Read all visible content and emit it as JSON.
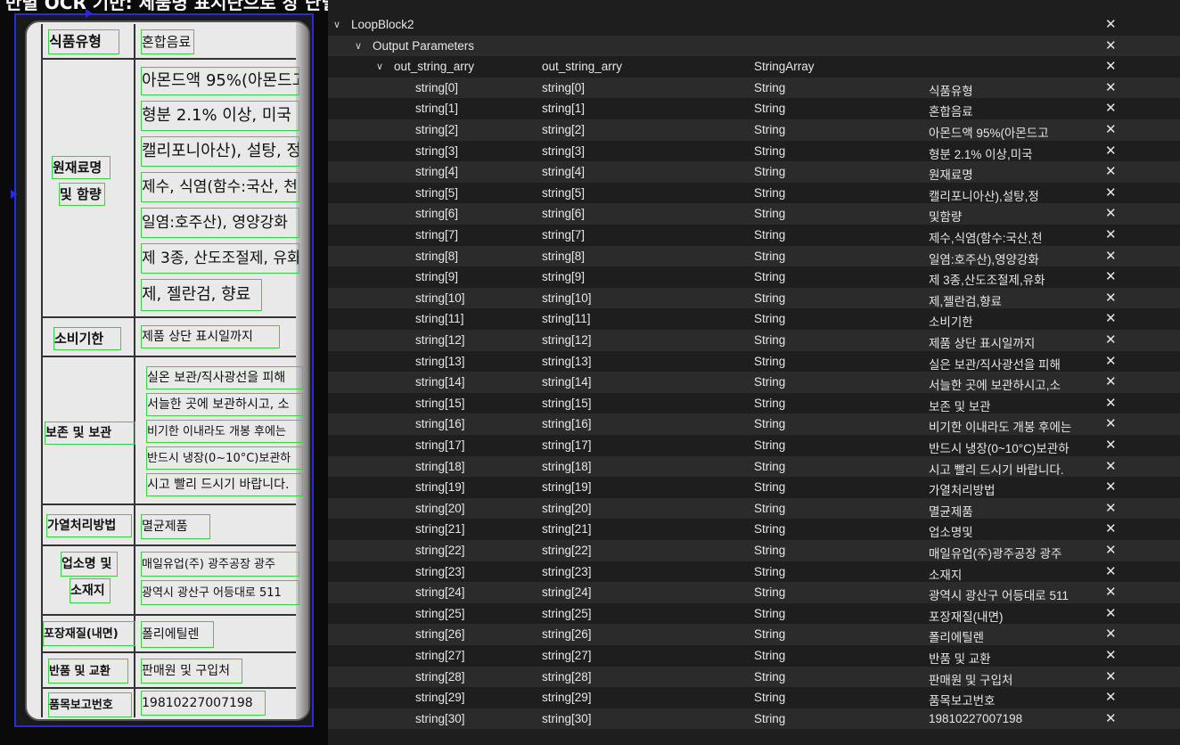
{
  "banner": {
    "text": "반별 OCR 기반: 제품명 표시란으로 장 단별 판정 텍스트 기"
  },
  "tree": {
    "root_label": "LoopBlock2",
    "group_label": "Output Parameters",
    "param": {
      "name": "out_string_arry",
      "display": "out_string_arry",
      "type": "StringArray"
    },
    "close_glyph": "✕",
    "rows": [
      {
        "name": "string[0]",
        "display": "string[0]",
        "type": "String",
        "value": "식품유형"
      },
      {
        "name": "string[1]",
        "display": "string[1]",
        "type": "String",
        "value": "혼합음료"
      },
      {
        "name": "string[2]",
        "display": "string[2]",
        "type": "String",
        "value": "아몬드액 95%(아몬드고"
      },
      {
        "name": "string[3]",
        "display": "string[3]",
        "type": "String",
        "value": "형분 2.1% 이상,미국"
      },
      {
        "name": "string[4]",
        "display": "string[4]",
        "type": "String",
        "value": "원재료명"
      },
      {
        "name": "string[5]",
        "display": "string[5]",
        "type": "String",
        "value": "캘리포니아산),설탕,정"
      },
      {
        "name": "string[6]",
        "display": "string[6]",
        "type": "String",
        "value": "및함량"
      },
      {
        "name": "string[7]",
        "display": "string[7]",
        "type": "String",
        "value": "제수,식염(함수:국산,천"
      },
      {
        "name": "string[8]",
        "display": "string[8]",
        "type": "String",
        "value": "일염:호주산),영양강화"
      },
      {
        "name": "string[9]",
        "display": "string[9]",
        "type": "String",
        "value": "제 3종,산도조절제,유화"
      },
      {
        "name": "string[10]",
        "display": "string[10]",
        "type": "String",
        "value": "제,젤란검,향료"
      },
      {
        "name": "string[11]",
        "display": "string[11]",
        "type": "String",
        "value": "소비기한"
      },
      {
        "name": "string[12]",
        "display": "string[12]",
        "type": "String",
        "value": "제품 상단 표시일까지"
      },
      {
        "name": "string[13]",
        "display": "string[13]",
        "type": "String",
        "value": "실은 보관/직사광선을 피해"
      },
      {
        "name": "string[14]",
        "display": "string[14]",
        "type": "String",
        "value": "서늘한 곳에 보관하시고,소"
      },
      {
        "name": "string[15]",
        "display": "string[15]",
        "type": "String",
        "value": "보존 및 보관"
      },
      {
        "name": "string[16]",
        "display": "string[16]",
        "type": "String",
        "value": "비기한 이내라도 개봉 후에는"
      },
      {
        "name": "string[17]",
        "display": "string[17]",
        "type": "String",
        "value": "반드시 냉장(0~10°C)보관하"
      },
      {
        "name": "string[18]",
        "display": "string[18]",
        "type": "String",
        "value": "시고 빨리 드시기 바랍니다."
      },
      {
        "name": "string[19]",
        "display": "string[19]",
        "type": "String",
        "value": "가열처리방법"
      },
      {
        "name": "string[20]",
        "display": "string[20]",
        "type": "String",
        "value": "멸균제품"
      },
      {
        "name": "string[21]",
        "display": "string[21]",
        "type": "String",
        "value": "업소명및"
      },
      {
        "name": "string[22]",
        "display": "string[22]",
        "type": "String",
        "value": "매일유업(주)광주공장 광주"
      },
      {
        "name": "string[23]",
        "display": "string[23]",
        "type": "String",
        "value": "소재지"
      },
      {
        "name": "string[24]",
        "display": "string[24]",
        "type": "String",
        "value": "광역시 광산구 어등대로 511"
      },
      {
        "name": "string[25]",
        "display": "string[25]",
        "type": "String",
        "value": "포장재질(내면)"
      },
      {
        "name": "string[26]",
        "display": "string[26]",
        "type": "String",
        "value": "폴리에틸렌"
      },
      {
        "name": "string[27]",
        "display": "string[27]",
        "type": "String",
        "value": "반품 및 교환"
      },
      {
        "name": "string[28]",
        "display": "string[28]",
        "type": "String",
        "value": "판매원 및 구입처"
      },
      {
        "name": "string[29]",
        "display": "string[29]",
        "type": "String",
        "value": "품목보고번호"
      },
      {
        "name": "string[30]",
        "display": "string[30]",
        "type": "String",
        "value": "19810227007198"
      }
    ]
  },
  "label_image": {
    "texts": [
      "식품유형",
      "혼합음료",
      "아몬드액 95%(아몬드고",
      "형분 2.1% 이상, 미국",
      "캘리포니아산), 설탕, 정",
      "원재료명",
      "및 함량",
      "제수, 식염(함수:국산, 천",
      "일염:호주산), 영양강화",
      "제 3종, 산도조절제, 유화",
      "제, 젤란검, 향료",
      "소비기한",
      "제품 상단 표시일까지",
      "실온 보관/직사광선을 피해",
      "서늘한 곳에 보관하시고, 소",
      "보존 및 보관",
      "비기한 이내라도 개봉 후에는",
      "반드시 냉장(0~10°C)보관하",
      "시고 빨리 드시기 바랍니다.",
      "가열처리방법",
      "멸균제품",
      "업소명 및",
      "매일유업(주) 광주공장 광주",
      "소재지",
      "광역시 광산구 어등대로 511",
      "포장재질(내면)",
      "폴리에틸렌",
      "반품 및 교환",
      "판매원 및 구입처",
      "품목보고번호",
      "19810227007198"
    ]
  },
  "colors": {
    "ocr_box": "#3ed13e",
    "frame": "#2a2ad8",
    "row_alt": "#2b2b2b",
    "panel_bg": "#1e1e1e"
  }
}
